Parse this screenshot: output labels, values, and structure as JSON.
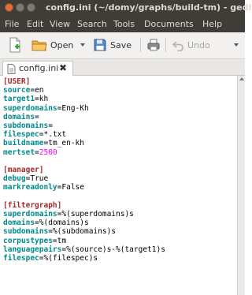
{
  "window": {
    "title": "config.ini (~/domy/graphs/build-tm) - gedit"
  },
  "menu": [
    "File",
    "Edit",
    "View",
    "Search",
    "Tools",
    "Documents",
    "Help"
  ],
  "toolbar": {
    "open_label": "Open",
    "save_label": "Save",
    "undo_label": "Undo"
  },
  "tab": {
    "label": "config.ini"
  },
  "lines": [
    {
      "type": "section",
      "text": "[USER]"
    },
    {
      "type": "kv",
      "key": "source",
      "value": "en"
    },
    {
      "type": "kv",
      "key": "target1",
      "value": "kh"
    },
    {
      "type": "kv",
      "key": "superdomains",
      "value": "Eng-Kh"
    },
    {
      "type": "kv",
      "key": "domains",
      "value": ""
    },
    {
      "type": "kv",
      "key": "subdomains",
      "value": ""
    },
    {
      "type": "kv",
      "key": "filespec",
      "value": "*.txt"
    },
    {
      "type": "kv",
      "key": "buildname",
      "value": "tm_en-kh"
    },
    {
      "type": "kv",
      "key": "mertset",
      "value": "2500",
      "numeric": true
    },
    {
      "type": "blank"
    },
    {
      "type": "section",
      "text": "[manager]"
    },
    {
      "type": "kv",
      "key": "debug",
      "value": "True"
    },
    {
      "type": "kv",
      "key": "markreadonly",
      "value": "False"
    },
    {
      "type": "blank"
    },
    {
      "type": "section",
      "text": "[filtergraph]"
    },
    {
      "type": "kv",
      "key": "superdomains",
      "value": "%(superdomains)s"
    },
    {
      "type": "kv",
      "key": "domains",
      "value": "%(domains)s"
    },
    {
      "type": "kv",
      "key": "subdomains",
      "value": "%(subdomains)s"
    },
    {
      "type": "kv",
      "key": "corpustypes",
      "value": "tm"
    },
    {
      "type": "kv",
      "key": "languagepairs",
      "value": "%(source)s-%(target1)s"
    },
    {
      "type": "kv",
      "key": "filespec",
      "value": "%(filespec)s"
    }
  ]
}
